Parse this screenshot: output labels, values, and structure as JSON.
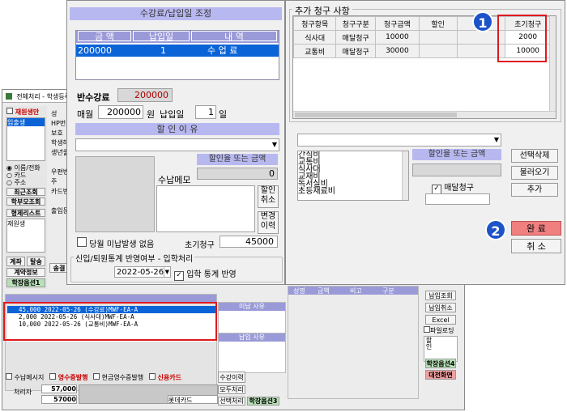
{
  "bg_window": {
    "title": "전체처리 - 학생등록, 수강",
    "sidebar_filters": [
      "재원생만",
      "입출생"
    ],
    "radio_options": [
      "이름/전화",
      "카드",
      "주소"
    ],
    "buttons": [
      "최근조회",
      "학부모조회",
      "형제리스트",
      "재원생",
      "계좌",
      "탈송",
      "계약정보",
      "학장옵션1",
      "송결"
    ],
    "labels": [
      "성",
      "HP번",
      "보호",
      "학생해",
      "생년월",
      "우편번",
      "주",
      "카드번",
      "출입문"
    ],
    "tuition_lines": [
      "45,000  2022-05-26  (수강료)MWF-EA-A",
      "2,000  2022-05-26  (식사대)MWF-EA-A",
      "10,000  2022-05-26  (교통비)MWF-EA-A"
    ],
    "unpaid_title": "미납 사유",
    "paid_title": "납입 사유",
    "bottom_checks": [
      "수납메시지",
      "영수증발행",
      "현금영수증발행",
      "신용카드"
    ],
    "bottom_buttons": [
      "수강이력",
      "모두처리",
      "선택처리",
      "학장옵션3"
    ],
    "processor_label": "처리자",
    "totals": [
      "57,000",
      "57000"
    ],
    "card_select": "롯데카드",
    "right_buttons": [
      "납입조회",
      "납입취소",
      "Excel",
      "학장옵션4",
      "대전화면"
    ],
    "paid_month_label": "파일로딩",
    "status_headers": [
      "성명",
      "금액",
      "비고",
      "구분"
    ],
    "discount_label": "할인",
    "enter_label": "입력"
  },
  "left_dialog": {
    "title": "수강료/납입일 조정",
    "table_headers": [
      "금 액",
      "납입일",
      "내 역"
    ],
    "table_row": [
      "200000",
      "1",
      "수 업 료"
    ],
    "refund_label": "반수강료",
    "refund_value": "200000",
    "monthly_label": "매월",
    "monthly_value": "200000",
    "won_label": "원",
    "pay_day_label": "납입일",
    "pay_day_value": "1",
    "day_label": "일",
    "discount_reason_title": "할 인 이 유",
    "discount_rate_label": "할인율 또는 금액",
    "discount_rate_value": "0",
    "memo_label": "수납메모",
    "discount_cancel_button": "할인\n취소",
    "change_history_button": "변경\n이력",
    "no_unpaid_label": "당월 미납발생 없음",
    "initial_bill_label": "초기청구",
    "initial_bill_value": "45000",
    "stats_label": "신입/퇴원통계 반영여부 - 입학처리",
    "date_value": "2022-05-26",
    "stats_checkbox_label": "입학 통계 반영"
  },
  "right_dialog": {
    "section_title": "추가 청구 사항",
    "columns": [
      "청구항목",
      "청구구분",
      "청구금액",
      "할인",
      "할인",
      "초기청구"
    ],
    "rows": [
      [
        "식사대",
        "매달청구",
        "10000",
        "",
        "",
        "2000"
      ],
      [
        "교통비",
        "매달청구",
        "30000",
        "",
        "",
        "10000"
      ]
    ],
    "items_list": [
      "간식비",
      "교통비",
      "식사대",
      "교재비",
      "독서실비",
      "초등재료비"
    ],
    "discount_label": "할인율 또는 금액",
    "monthly_checkbox_label": "매달청구",
    "buttons": [
      "선택삭제",
      "불러오기",
      "추가"
    ],
    "complete_button": "완 료",
    "cancel_button": "취 소"
  },
  "callouts": [
    "1",
    "2"
  ],
  "colors": {
    "accent_blue": "#1d53c9",
    "highlight_red": "#e0191f",
    "selection_blue": "#0a64d8",
    "header_lavender": "#b8b8f0",
    "complete_pink": "#f08080"
  }
}
